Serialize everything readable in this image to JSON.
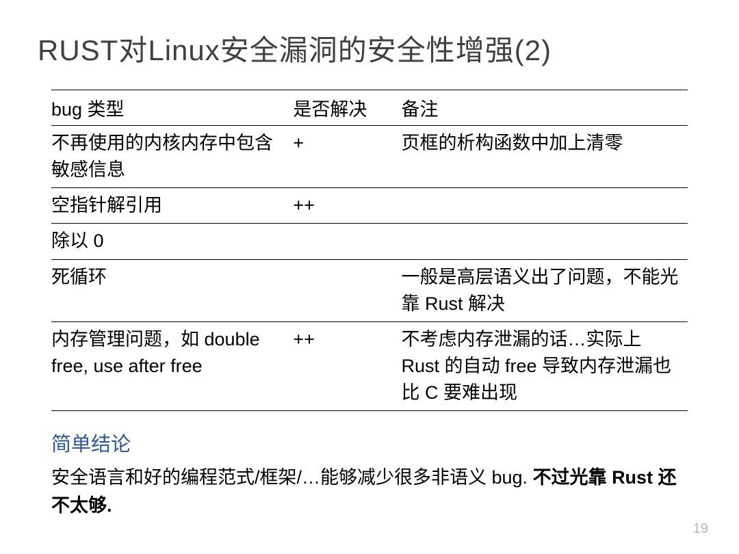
{
  "title": "RUST对Linux安全漏洞的安全性增强(2)",
  "table": {
    "headers": {
      "c0": "bug 类型",
      "c1": "是否解决",
      "c2": "备注"
    },
    "rows": [
      {
        "c0": "不再使用的内核内存中包含敏感信息",
        "c1": "+",
        "c2": "页框的析构函数中加上清零"
      },
      {
        "c0": "空指针解引用",
        "c1": "++",
        "c2": ""
      },
      {
        "c0": "除以 0",
        "c1": "",
        "c2": ""
      },
      {
        "c0": "死循环",
        "c1": "",
        "c2": "一般是高层语义出了问题，不能光靠 Rust 解决"
      },
      {
        "c0": "内存管理问题，如 double free, use after free",
        "c1": "++",
        "c2": "不考虑内存泄漏的话…实际上 Rust 的自动 free 导致内存泄漏也比 C 要难出现"
      }
    ]
  },
  "conclusion": {
    "heading": "简单结论",
    "body_pre": "安全语言和好的编程范式/框架/…能够减少很多非语义 bug. ",
    "body_bold": "不过光靠 Rust 还不太够."
  },
  "page_number": "19"
}
